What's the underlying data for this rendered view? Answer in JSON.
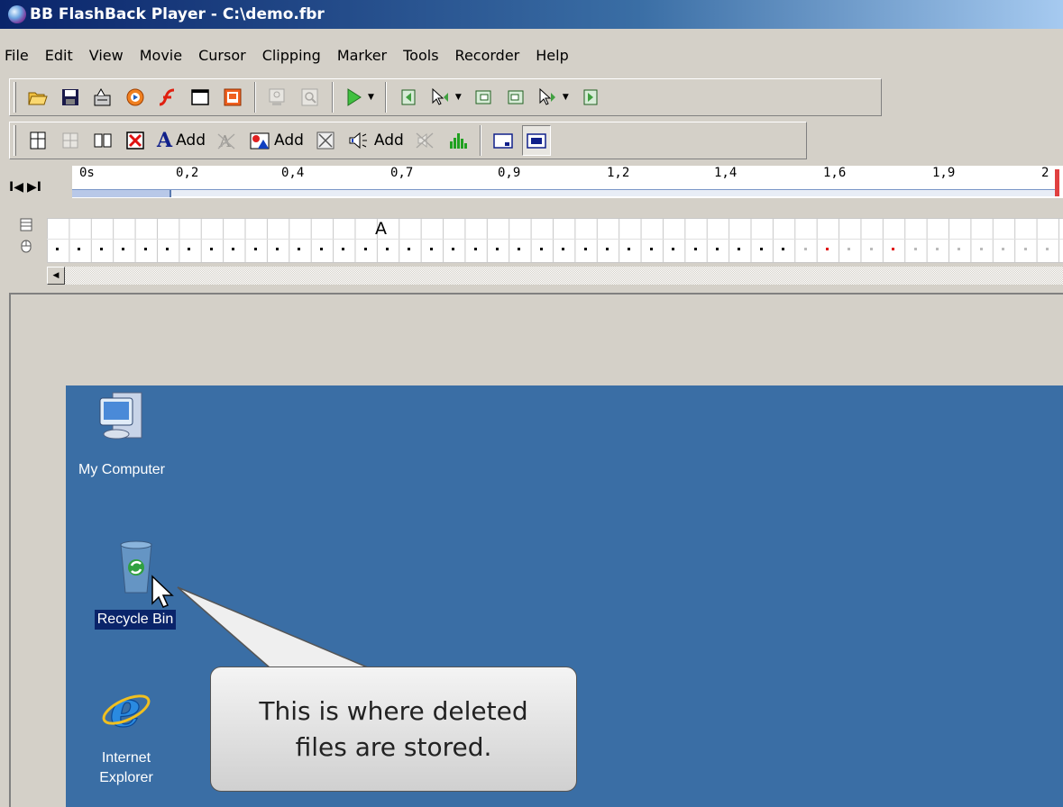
{
  "window": {
    "title": "BB FlashBack Player - C:\\demo.fbr"
  },
  "menu": [
    "File",
    "Edit",
    "View",
    "Movie",
    "Cursor",
    "Clipping",
    "Marker",
    "Tools",
    "Recorder",
    "Help"
  ],
  "toolbar2": {
    "add_text_label": "Add",
    "add_image_label": "Add",
    "add_sound_label": "Add"
  },
  "timeline": {
    "ticks": [
      "0s",
      "0,2",
      "0,4",
      "0,7",
      "0,9",
      "1,2",
      "1,4",
      "1,6",
      "1,9",
      "2"
    ],
    "nav_first": "I◀",
    "nav_next": "▶I"
  },
  "grid": {
    "marker_text": "A"
  },
  "desktop": {
    "icons": {
      "my_computer": "My Computer",
      "recycle_bin": "Recycle Bin",
      "ie_line1": "Internet",
      "ie_line2": "Explorer"
    }
  },
  "callout": {
    "line1": "This is where deleted",
    "line2": "files are stored."
  },
  "colors": {
    "desktop": "#3a6ea5",
    "title_start": "#0a246a",
    "chrome": "#d4d0c8"
  }
}
